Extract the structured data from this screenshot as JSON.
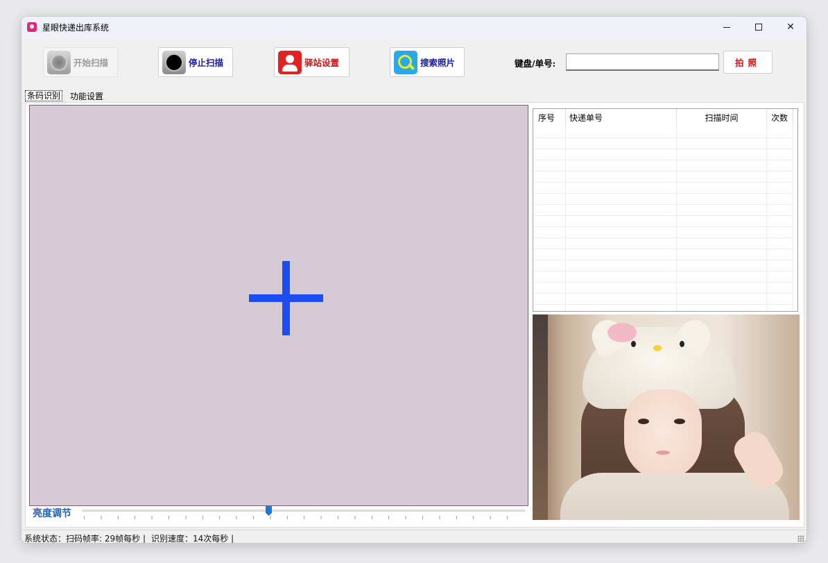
{
  "window": {
    "title": "星眼快递出库系统",
    "minimize_icon": "minimize-icon",
    "maximize_icon": "maximize-icon",
    "close_icon": "close-icon",
    "close_symbol": "✕"
  },
  "toolbar": {
    "start_scan": {
      "label": "开始扫描",
      "icon": "camera-lens-icon",
      "enabled": false
    },
    "stop_scan": {
      "label": "停止扫描",
      "icon": "stop-record-icon"
    },
    "station_settings": {
      "label": "驿站设置",
      "icon": "user-icon"
    },
    "search_photos": {
      "label": "搜索照片",
      "icon": "magnifier-icon"
    },
    "keyboard_label": "键盘/单号:",
    "keyboard_value": "",
    "photo_button": "拍照"
  },
  "tabs": [
    {
      "label": "条码识别",
      "active": true
    },
    {
      "label": "功能设置",
      "active": false
    }
  ],
  "camera": {
    "crosshair_icon": "crosshair-icon",
    "background": "#d6cad4",
    "crosshair_color": "#1d4cf0"
  },
  "brightness": {
    "label": "亮度调节",
    "value_fraction": 0.42
  },
  "grid": {
    "columns": [
      "序号",
      "快递单号",
      "扫描时间",
      "次数"
    ],
    "rows": []
  },
  "status_bar": {
    "status": "系统状态：扫码帧率: 29帧每秒 |",
    "speed": "识别速度：14次每秒 |"
  },
  "colors": {
    "accent_blue": "#1a1aa8",
    "accent_red": "#d81010",
    "brightness_label": "#1f5fb5",
    "slider_thumb": "#1a78d8"
  }
}
